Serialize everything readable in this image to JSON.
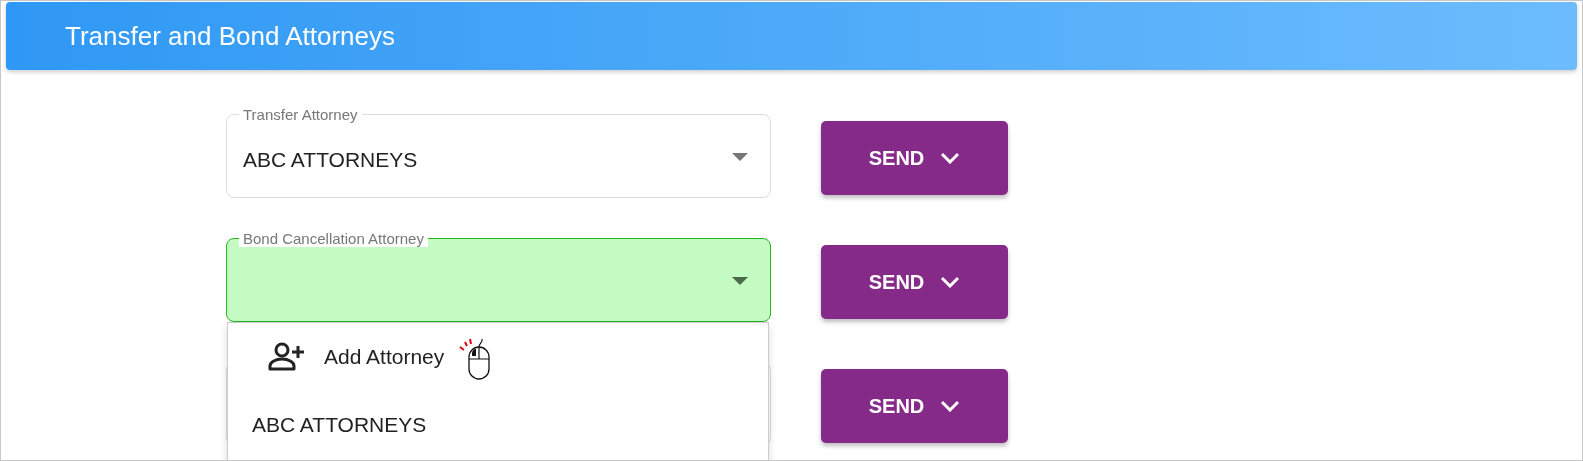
{
  "header": {
    "title": "Transfer and Bond Attorneys"
  },
  "rows": [
    {
      "field": {
        "label": "Transfer Attorney",
        "value": "ABC ATTORNEYS",
        "highlighted": false,
        "open": false
      },
      "button": "SEND"
    },
    {
      "field": {
        "label": "Bond Cancellation Attorney",
        "highlighted": true,
        "open": true
      },
      "button": "SEND"
    },
    {
      "field": {
        "highlighted": false,
        "open": false
      },
      "button": "SEND"
    }
  ],
  "menu": {
    "items": [
      {
        "kind": "action",
        "label": "Add Attorney"
      },
      {
        "kind": "option",
        "label": "ABC ATTORNEYS"
      }
    ]
  }
}
